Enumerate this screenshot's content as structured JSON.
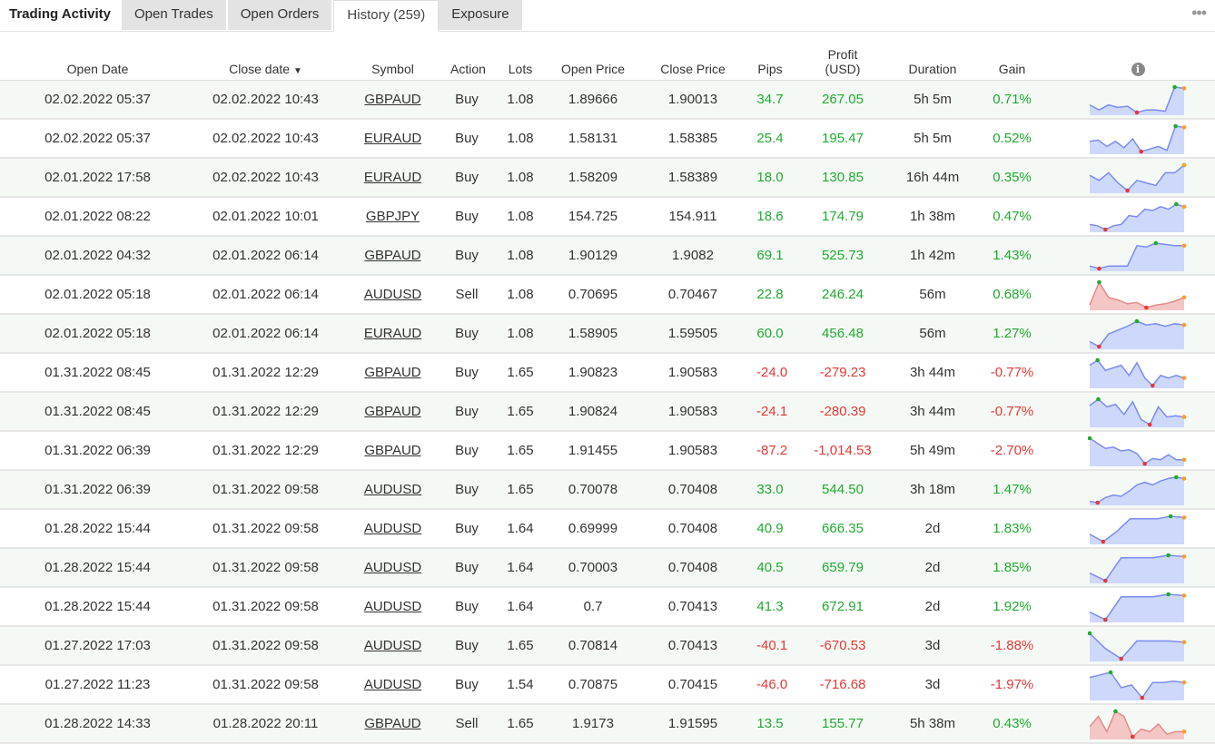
{
  "tabs": {
    "title": "Trading Activity",
    "items": [
      {
        "label": "Open Trades"
      },
      {
        "label": "Open Orders"
      },
      {
        "label": "History (259)"
      },
      {
        "label": "Exposure"
      }
    ],
    "more": "•••"
  },
  "headers": {
    "open_date": "Open Date",
    "close_date": "Close date",
    "sort_indicator": "▼",
    "symbol": "Symbol",
    "action": "Action",
    "lots": "Lots",
    "open_price": "Open Price",
    "close_price": "Close Price",
    "pips": "Pips",
    "profit_line1": "Profit",
    "profit_line2": "(USD)",
    "duration": "Duration",
    "gain": "Gain",
    "info": "i"
  },
  "colors": {
    "positive": "#1faa2f",
    "negative": "#e53935"
  },
  "trades": [
    {
      "open": "02.02.2022 05:37",
      "close": "02.02.2022 10:43",
      "symbol": "GBPAUD",
      "action": "Buy",
      "lots": "1.08",
      "open_price": "1.89666",
      "close_price": "1.90013",
      "pips": "34.7",
      "profit": "267.05",
      "duration": "5h 5m",
      "gain": "0.71%",
      "spark": [
        0.3,
        0.1,
        0.3,
        0.2,
        0.25,
        0.0,
        0.1,
        0.1,
        0.05,
        1.0,
        0.95
      ],
      "min": 5,
      "max": 9
    },
    {
      "open": "02.02.2022 05:37",
      "close": "02.02.2022 10:43",
      "symbol": "EURAUD",
      "action": "Buy",
      "lots": "1.08",
      "open_price": "1.58131",
      "close_price": "1.58385",
      "pips": "25.4",
      "profit": "195.47",
      "duration": "5h 5m",
      "gain": "0.52%",
      "spark": [
        0.4,
        0.45,
        0.2,
        0.4,
        0.15,
        0.5,
        0.0,
        0.1,
        0.2,
        0.05,
        1.0,
        0.95
      ],
      "min": 6,
      "max": 10
    },
    {
      "open": "02.01.2022 17:58",
      "close": "02.02.2022 10:43",
      "symbol": "EURAUD",
      "action": "Buy",
      "lots": "1.08",
      "open_price": "1.58209",
      "close_price": "1.58389",
      "pips": "18.0",
      "profit": "130.85",
      "duration": "16h 44m",
      "gain": "0.35%",
      "spark": [
        0.6,
        0.4,
        0.7,
        0.3,
        0.0,
        0.4,
        0.3,
        0.2,
        0.7,
        0.7,
        1.0
      ],
      "min": 4,
      "max": 10
    },
    {
      "open": "02.01.2022 08:22",
      "close": "02.01.2022 10:01",
      "symbol": "GBPJPY",
      "action": "Buy",
      "lots": "1.08",
      "open_price": "154.725",
      "close_price": "154.911",
      "pips": "18.6",
      "profit": "174.79",
      "duration": "1h 38m",
      "gain": "0.47%",
      "spark": [
        0.2,
        0.15,
        0.0,
        0.15,
        0.2,
        0.55,
        0.5,
        0.8,
        0.75,
        0.9,
        0.8,
        1.0,
        0.9
      ],
      "min": 2,
      "max": 11
    },
    {
      "open": "02.01.2022 04:32",
      "close": "02.01.2022 06:14",
      "symbol": "GBPAUD",
      "action": "Buy",
      "lots": "1.08",
      "open_price": "1.90129",
      "close_price": "1.9082",
      "pips": "69.1",
      "profit": "525.73",
      "duration": "1h 42m",
      "gain": "1.43%",
      "spark": [
        0.1,
        0.0,
        0.1,
        0.1,
        0.1,
        0.9,
        0.85,
        1.0,
        0.95,
        0.9,
        0.9
      ],
      "min": 1,
      "max": 7
    },
    {
      "open": "02.01.2022 05:18",
      "close": "02.01.2022 06:14",
      "symbol": "AUDUSD",
      "action": "Sell",
      "lots": "1.08",
      "open_price": "0.70695",
      "close_price": "0.70467",
      "pips": "22.8",
      "profit": "246.24",
      "duration": "56m",
      "gain": "0.68%",
      "spark": [
        0.1,
        1.0,
        0.4,
        0.3,
        0.15,
        0.2,
        0.0,
        0.1,
        0.15,
        0.25,
        0.4
      ],
      "min": 6,
      "max": 1,
      "neg": true
    },
    {
      "open": "02.01.2022 05:18",
      "close": "02.01.2022 06:14",
      "symbol": "EURAUD",
      "action": "Buy",
      "lots": "1.08",
      "open_price": "1.58905",
      "close_price": "1.59505",
      "pips": "60.0",
      "profit": "456.48",
      "duration": "56m",
      "gain": "1.27%",
      "spark": [
        0.2,
        0.0,
        0.5,
        0.65,
        0.8,
        1.0,
        0.85,
        0.9,
        0.8,
        0.9,
        0.85
      ],
      "min": 1,
      "max": 5
    },
    {
      "open": "01.31.2022 08:45",
      "close": "01.31.2022 12:29",
      "symbol": "GBPAUD",
      "action": "Buy",
      "lots": "1.65",
      "open_price": "1.90823",
      "close_price": "1.90583",
      "pips": "-24.0",
      "profit": "-279.23",
      "duration": "3h 44m",
      "gain": "-0.77%",
      "spark": [
        0.8,
        1.0,
        0.6,
        0.7,
        0.8,
        0.4,
        0.9,
        0.3,
        0.0,
        0.4,
        0.3,
        0.4,
        0.3
      ],
      "min": 8,
      "max": 1
    },
    {
      "open": "01.31.2022 08:45",
      "close": "01.31.2022 12:29",
      "symbol": "GBPAUD",
      "action": "Buy",
      "lots": "1.65",
      "open_price": "1.90824",
      "close_price": "1.90583",
      "pips": "-24.1",
      "profit": "-280.39",
      "duration": "3h 44m",
      "gain": "-0.77%",
      "spark": [
        0.75,
        1.0,
        0.7,
        0.8,
        0.4,
        0.9,
        0.2,
        0.0,
        0.7,
        0.3,
        0.35,
        0.3
      ],
      "min": 7,
      "max": 1
    },
    {
      "open": "01.31.2022 06:39",
      "close": "01.31.2022 12:29",
      "symbol": "GBPAUD",
      "action": "Buy",
      "lots": "1.65",
      "open_price": "1.91455",
      "close_price": "1.90583",
      "pips": "-87.2",
      "profit": "-1,014.53",
      "duration": "5h 49m",
      "gain": "-2.70%",
      "spark": [
        1.0,
        0.8,
        0.6,
        0.65,
        0.5,
        0.55,
        0.4,
        0.0,
        0.2,
        0.15,
        0.35,
        0.15,
        0.15
      ],
      "min": 7,
      "max": 0
    },
    {
      "open": "01.31.2022 06:39",
      "close": "01.31.2022 09:58",
      "symbol": "AUDUSD",
      "action": "Buy",
      "lots": "1.65",
      "open_price": "0.70078",
      "close_price": "0.70408",
      "pips": "33.0",
      "profit": "544.50",
      "duration": "3h 18m",
      "gain": "1.47%",
      "spark": [
        0.05,
        0.0,
        0.2,
        0.3,
        0.25,
        0.45,
        0.7,
        0.8,
        0.7,
        0.85,
        0.95,
        1.0,
        0.95
      ],
      "min": 1,
      "max": 11
    },
    {
      "open": "01.28.2022 15:44",
      "close": "01.31.2022 09:58",
      "symbol": "AUDUSD",
      "action": "Buy",
      "lots": "1.64",
      "open_price": "0.69999",
      "close_price": "0.70408",
      "pips": "40.9",
      "profit": "666.35",
      "duration": "2d",
      "gain": "1.83%",
      "spark": [
        0.3,
        0.0,
        0.4,
        0.9,
        0.9,
        0.9,
        1.0,
        0.95
      ],
      "min": 1,
      "max": 6
    },
    {
      "open": "01.28.2022 15:44",
      "close": "01.31.2022 09:58",
      "symbol": "AUDUSD",
      "action": "Buy",
      "lots": "1.64",
      "open_price": "0.70003",
      "close_price": "0.70408",
      "pips": "40.5",
      "profit": "659.79",
      "duration": "2d",
      "gain": "1.85%",
      "spark": [
        0.3,
        0.0,
        0.9,
        0.9,
        0.9,
        1.0,
        0.95
      ],
      "min": 1,
      "max": 5
    },
    {
      "open": "01.28.2022 15:44",
      "close": "01.31.2022 09:58",
      "symbol": "AUDUSD",
      "action": "Buy",
      "lots": "1.64",
      "open_price": "0.7",
      "close_price": "0.70413",
      "pips": "41.3",
      "profit": "672.91",
      "duration": "2d",
      "gain": "1.92%",
      "spark": [
        0.3,
        0.0,
        0.9,
        0.9,
        0.9,
        1.0,
        0.95
      ],
      "min": 1,
      "max": 5
    },
    {
      "open": "01.27.2022 17:03",
      "close": "01.31.2022 09:58",
      "symbol": "AUDUSD",
      "action": "Buy",
      "lots": "1.65",
      "open_price": "0.70814",
      "close_price": "0.70413",
      "pips": "-40.1",
      "profit": "-670.53",
      "duration": "3d",
      "gain": "-1.88%",
      "spark": [
        1.0,
        0.4,
        0.0,
        0.7,
        0.7,
        0.7,
        0.65
      ],
      "min": 2,
      "max": 0
    },
    {
      "open": "01.27.2022 11:23",
      "close": "01.31.2022 09:58",
      "symbol": "AUDUSD",
      "action": "Buy",
      "lots": "1.54",
      "open_price": "0.70875",
      "close_price": "0.70415",
      "pips": "-46.0",
      "profit": "-716.68",
      "duration": "3d",
      "gain": "-1.97%",
      "spark": [
        0.8,
        0.9,
        1.0,
        0.4,
        0.5,
        0.0,
        0.6,
        0.6,
        0.65,
        0.6
      ],
      "min": 5,
      "max": 2
    },
    {
      "open": "01.28.2022 14:33",
      "close": "01.28.2022 20:11",
      "symbol": "GBPAUD",
      "action": "Sell",
      "lots": "1.65",
      "open_price": "1.9173",
      "close_price": "1.91595",
      "pips": "13.5",
      "profit": "155.77",
      "duration": "5h 38m",
      "gain": "0.43%",
      "spark": [
        0.4,
        0.8,
        0.2,
        1.0,
        0.8,
        0.0,
        0.3,
        0.2,
        0.5,
        0.1,
        0.2,
        0.2
      ],
      "min": 5,
      "max": 3,
      "neg": true
    }
  ]
}
